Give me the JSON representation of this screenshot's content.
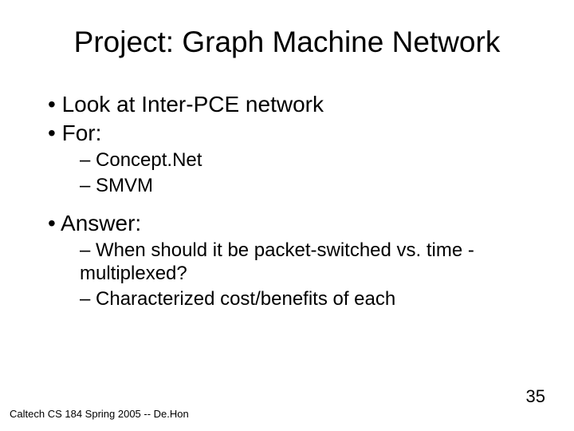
{
  "title": "Project: Graph Machine Network",
  "bullets": {
    "b1": "Look at Inter-PCE network",
    "b2": "For:",
    "b2a": "Concept.Net",
    "b2b": "SMVM",
    "b3": "Answer:",
    "b3a": "When should it be packet-switched vs. time -multiplexed?",
    "b3b": "Characterized cost/benefits of each"
  },
  "footer": "Caltech CS 184 Spring 2005 -- De.Hon",
  "page_number": "35"
}
